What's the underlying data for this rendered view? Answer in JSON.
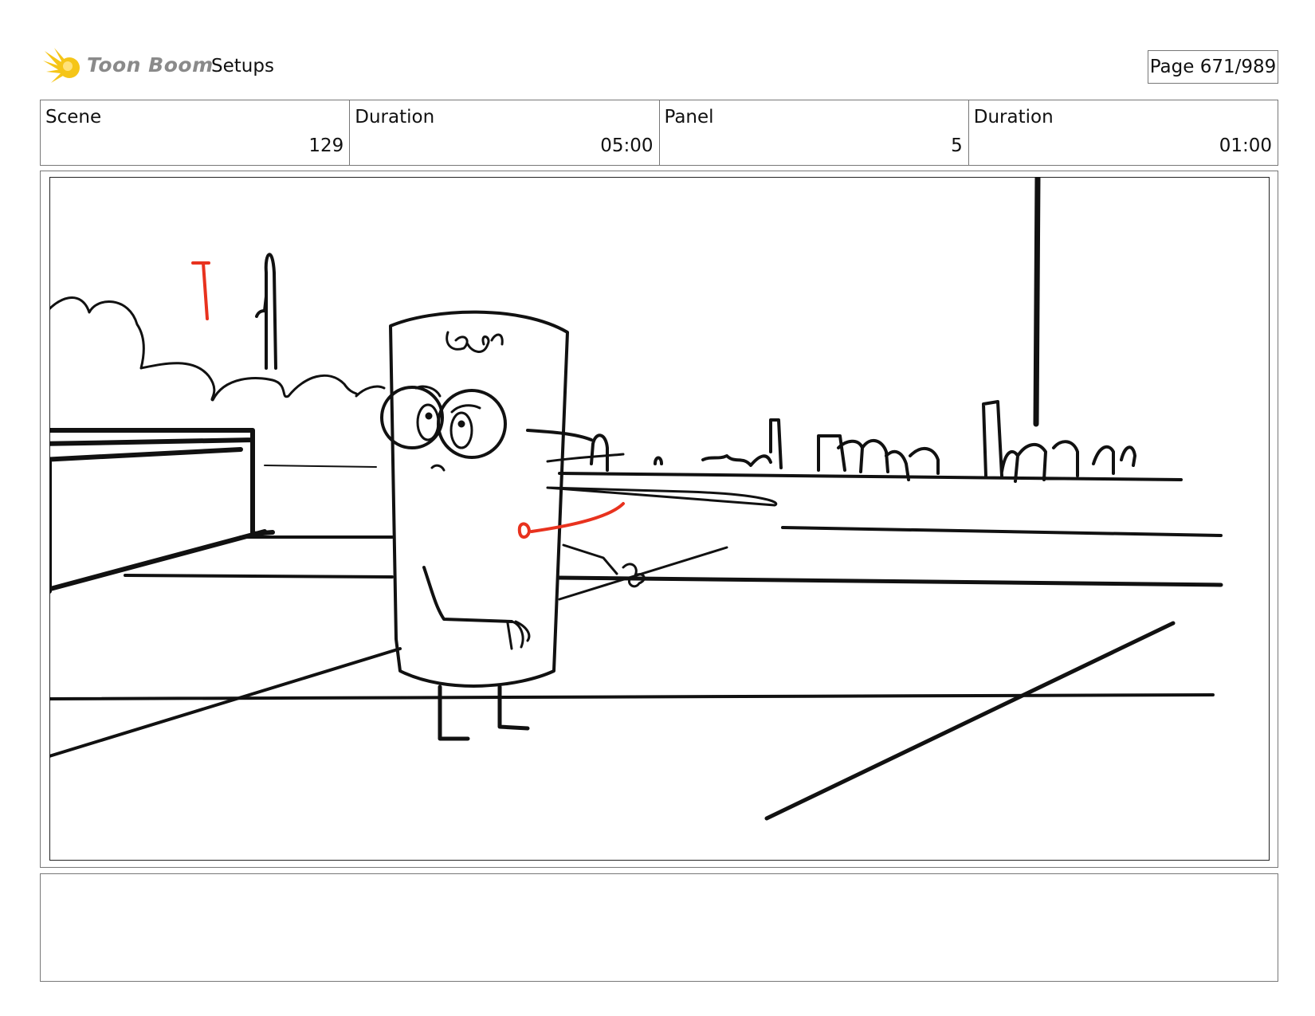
{
  "header": {
    "logo_text": "Toon Boom",
    "section_title": "Setups",
    "page_indicator": "Page 671/989"
  },
  "info": {
    "scene_label": "Scene",
    "scene_value": "129",
    "scene_duration_label": "Duration",
    "scene_duration_value": "05:00",
    "panel_label": "Panel",
    "panel_value": "5",
    "panel_duration_label": "Duration",
    "panel_duration_value": "01:00"
  },
  "panel": {
    "drawing": "storyboard-sketch"
  },
  "notes": {
    "text": ""
  },
  "colors": {
    "logo_yellow": "#f5c518",
    "border_gray": "#777777",
    "sketch_ink": "#111111",
    "sketch_red": "#e8321e"
  }
}
